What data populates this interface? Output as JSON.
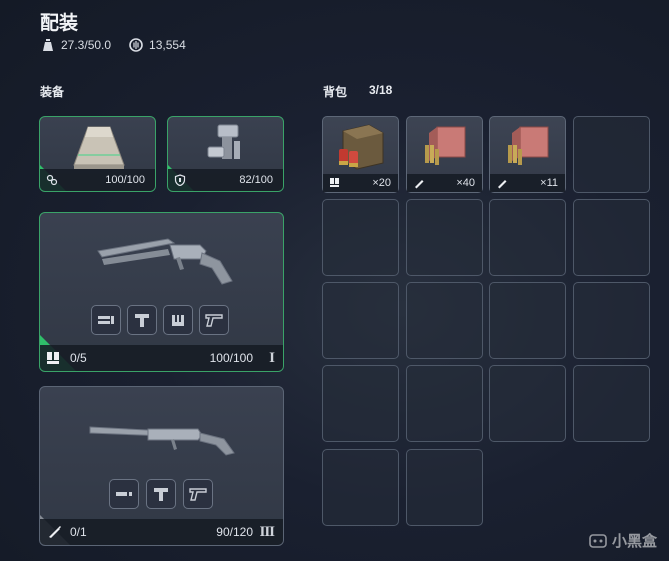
{
  "header": {
    "title": "配装",
    "weight": "27.3/50.0",
    "currency": "13,554"
  },
  "equipment": {
    "label": "装备",
    "armor": {
      "durability": "100/100",
      "icon": "armor-plate-icon"
    },
    "helmet": {
      "durability": "82/100",
      "icon": "shield-icon"
    },
    "primary_weapon": {
      "ammo": "0/5",
      "durability": "100/100",
      "tier": "I"
    },
    "secondary_weapon": {
      "ammo": "0/1",
      "durability": "90/120",
      "tier": "III"
    }
  },
  "backpack": {
    "label": "背包",
    "capacity": "3/18",
    "items": [
      {
        "name": "ammo-box-shells",
        "qty": "×20"
      },
      {
        "name": "ammo-crate-rifle",
        "qty": "×40"
      },
      {
        "name": "ammo-crate-rifle",
        "qty": "×11"
      }
    ]
  },
  "watermark": "小黑盒",
  "colors": {
    "accent_green": "#2fbf6a",
    "background": "#1a2030"
  }
}
